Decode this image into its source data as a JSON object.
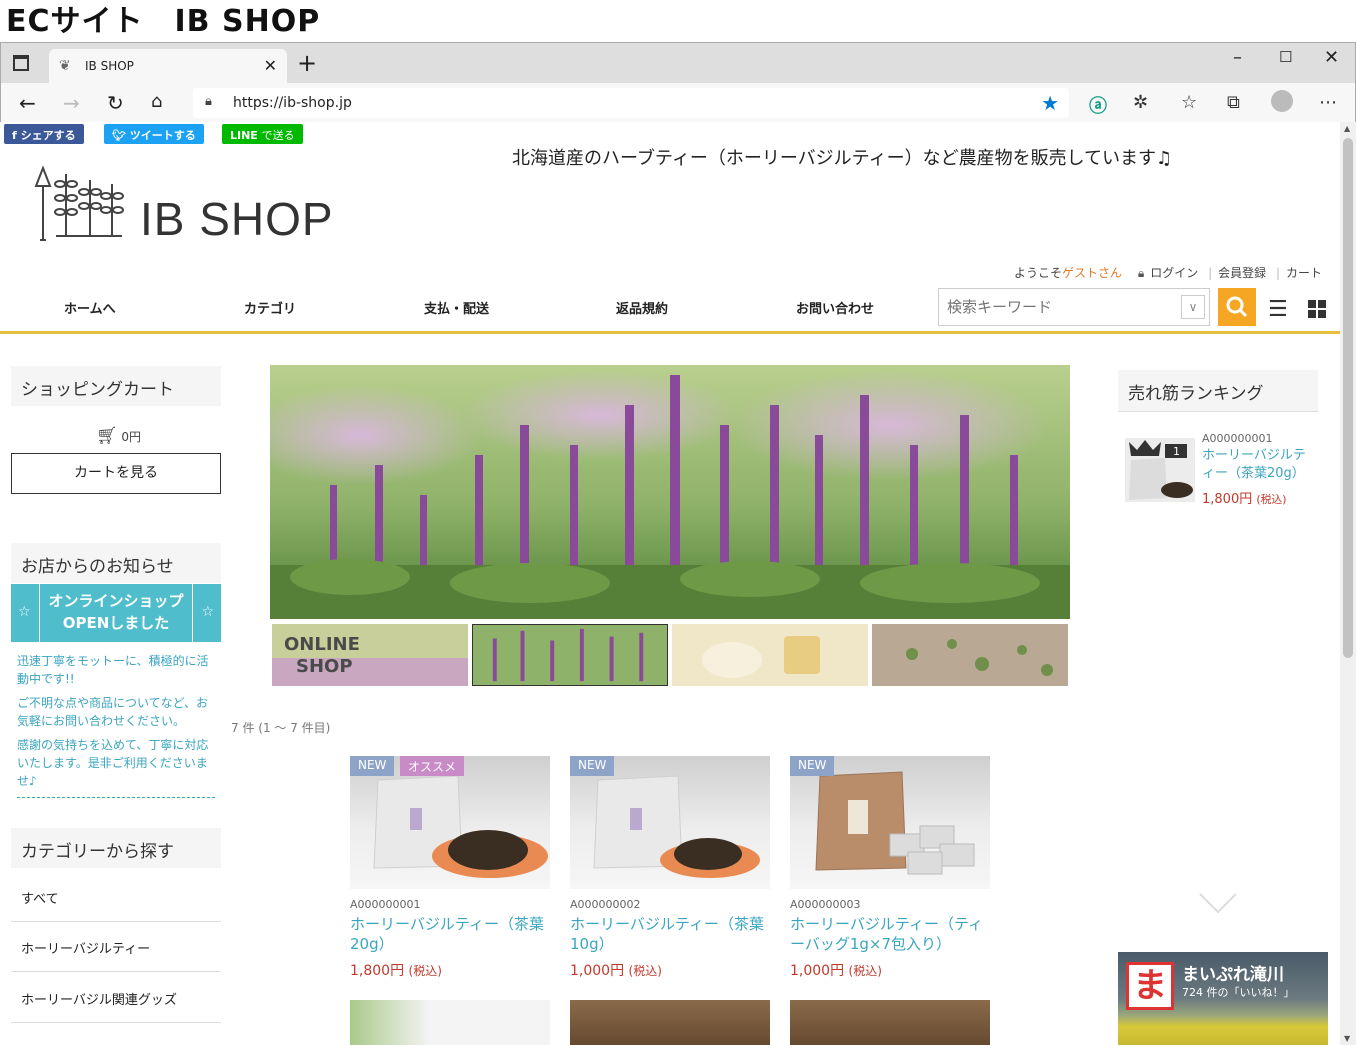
{
  "caption": "ECサイト　IB SHOP",
  "browser": {
    "tab_title": "IB SHOP",
    "url": "https://ib-shop.jp"
  },
  "social": {
    "facebook": "シェアする",
    "twitter": "ツイートする",
    "line_brand": "LINE",
    "line": "で送る"
  },
  "header": {
    "tagline": "北海道産のハーブティー（ホーリーバジルティー）など農産物を販売しています♫",
    "logo_text": "IB SHOP",
    "welcome_prefix": "ようこそ",
    "welcome_guest": "ゲストさん",
    "login": "ログイン",
    "register": "会員登録",
    "cart": "カート"
  },
  "nav": [
    "ホームへ",
    "カテゴリ",
    "支払・配送",
    "返品規約",
    "お問い合わせ"
  ],
  "search": {
    "placeholder": "検索キーワード"
  },
  "sidebar": {
    "cart_title": "ショッピングカート",
    "cart_amount": "0円",
    "cart_button": "カートを見る",
    "news_title": "お店からのお知らせ",
    "banner_line1": "オンラインショップ",
    "banner_line2": "OPENしました",
    "news": [
      "迅速丁寧をモットーに、積極的に活動中です!!",
      "ご不明な点や商品についてなど、お気軽にお問い合わせください。",
      "感謝の気持ちを込めて、丁寧に対応いたします。是非ご利用くださいませ♪"
    ],
    "category_title": "カテゴリーから探す",
    "categories": [
      "すべて",
      "ホーリーバジルティー",
      "ホーリーバジル関連グッズ"
    ]
  },
  "thumb_label_1": "ONLINE",
  "thumb_label_2": "SHOP",
  "result_count": "7 件 (1 ～ 7 件目)",
  "products": [
    {
      "badges": [
        "NEW",
        "オススメ"
      ],
      "code": "A000000001",
      "name": "ホーリーバジルティー（茶葉20g）",
      "price": "1,800円",
      "tax": "(税込)"
    },
    {
      "badges": [
        "NEW"
      ],
      "code": "A000000002",
      "name": "ホーリーバジルティー（茶葉10g）",
      "price": "1,000円",
      "tax": "(税込)"
    },
    {
      "badges": [
        "NEW"
      ],
      "code": "A000000003",
      "name": "ホーリーバジルティー（ティーバッグ1g×7包入り）",
      "price": "1,000円",
      "tax": "(税込)"
    }
  ],
  "ranking": {
    "title": "売れ筋ランキング",
    "rank": "1",
    "code": "A000000001",
    "name": "ホーリーバジルティー（茶葉20g）",
    "price": "1,800円",
    "tax": "(税込)"
  },
  "maipure": {
    "logo": "ま",
    "name": "まいぷれ滝川",
    "likes": "724 件の「いいね！」"
  },
  "colors": {
    "accent": "#3aa5bf",
    "price": "#c0392b",
    "gold": "#e3c13f",
    "search_button": "#f5a623"
  }
}
